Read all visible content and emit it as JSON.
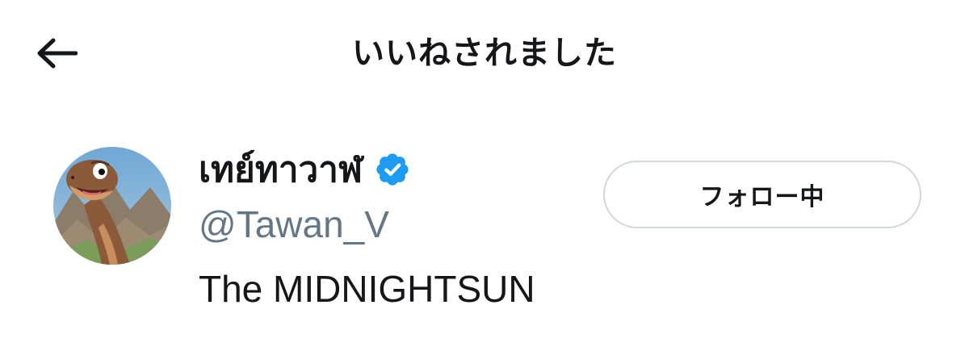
{
  "header": {
    "title": "いいねされました",
    "back_icon": "arrow-left-icon"
  },
  "user": {
    "display_name": "เทย์ทาวาฬ",
    "verified": true,
    "verified_icon": "verified-badge-icon",
    "handle": "@Tawan_V",
    "bio": "The MIDNIGHTSUN",
    "avatar_icon": "dinosaur-avatar"
  },
  "follow_button": {
    "label": "フォロー中"
  },
  "colors": {
    "text_primary": "#14171a",
    "text_secondary": "#657786",
    "verified_blue": "#1d9bf0",
    "button_border": "#cfd9de"
  }
}
